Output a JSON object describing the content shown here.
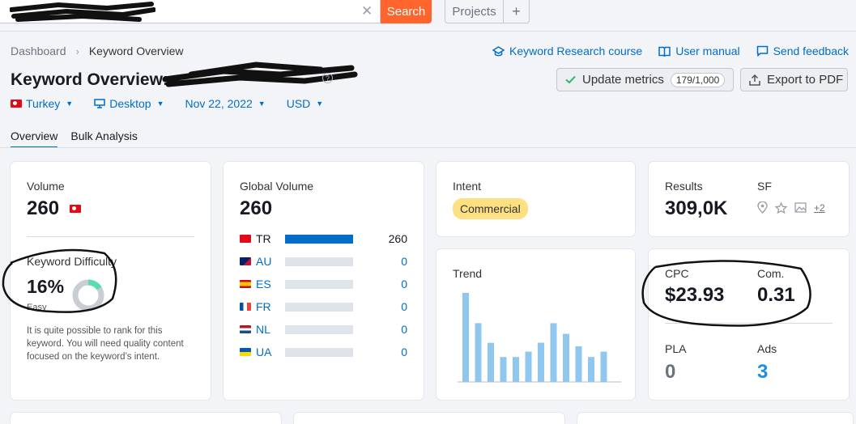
{
  "search": {
    "button_label": "Search",
    "clear_icon": "close-icon"
  },
  "projects": {
    "label": "Projects",
    "plus": "+"
  },
  "breadcrumb": {
    "root": "Dashboard",
    "current": "Keyword Overview"
  },
  "links": {
    "course": "Keyword Research course",
    "manual": "User manual",
    "feedback": "Send feedback"
  },
  "title": "Keyword Overview:",
  "buttons": {
    "update": "Update metrics",
    "update_count": "179/1,000",
    "export": "Export to PDF"
  },
  "filters": {
    "country": "Turkey",
    "device": "Desktop",
    "date": "Nov 22, 2022",
    "currency": "USD"
  },
  "tabs": [
    "Overview",
    "Bulk Analysis"
  ],
  "volume": {
    "label": "Volume",
    "value": "260"
  },
  "kd": {
    "label": "Keyword Difficulty",
    "value": "16%",
    "level": "Easy",
    "percent": 16,
    "description": "It is quite possible to rank for this keyword. You will need quality content focused on the keyword’s intent."
  },
  "global_volume": {
    "label": "Global Volume",
    "value": "260",
    "rows": [
      {
        "code": "TR",
        "value": "260",
        "fraction": 1.0
      },
      {
        "code": "AU",
        "value": "0",
        "fraction": 0
      },
      {
        "code": "ES",
        "value": "0",
        "fraction": 0
      },
      {
        "code": "FR",
        "value": "0",
        "fraction": 0
      },
      {
        "code": "NL",
        "value": "0",
        "fraction": 0
      },
      {
        "code": "UA",
        "value": "0",
        "fraction": 0
      }
    ]
  },
  "intent": {
    "label": "Intent",
    "value": "Commercial"
  },
  "trend": {
    "label": "Trend",
    "values": [
      100,
      66,
      44,
      28,
      28,
      34,
      44,
      66,
      54,
      40,
      28,
      34
    ]
  },
  "results": {
    "label": "Results",
    "value": "309,0K",
    "sf_label": "SF",
    "sf_more": "+2"
  },
  "cpc": {
    "label": "CPC",
    "value": "$23.93"
  },
  "com": {
    "label": "Com.",
    "value": "0.31"
  },
  "pla": {
    "label": "PLA",
    "value": "0"
  },
  "ads": {
    "label": "Ads",
    "value": "3"
  },
  "colors": {
    "accent": "#006dca",
    "brand": "#ff642d",
    "intent_badge": "#fce081",
    "kd_fill": "#59ddaa",
    "trend_bar": "#90c7ee"
  }
}
